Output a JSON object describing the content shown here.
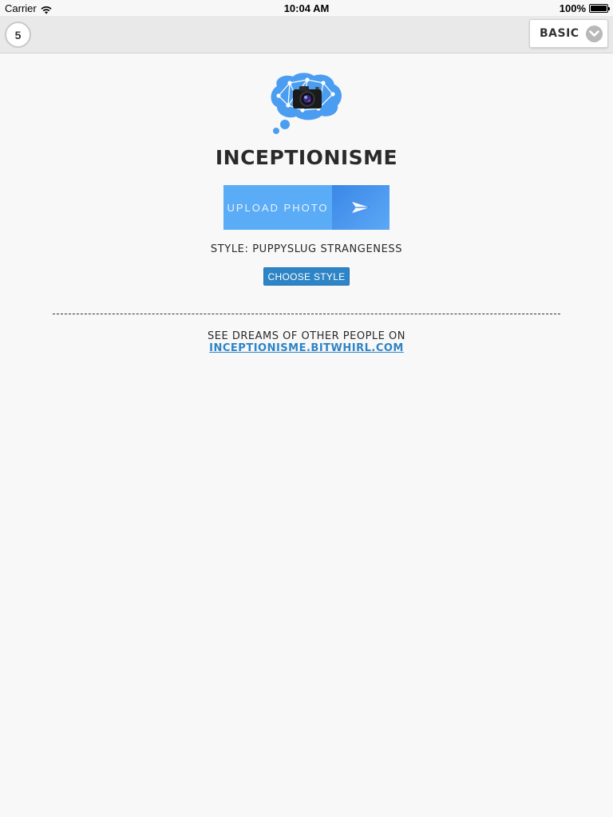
{
  "status_bar": {
    "carrier": "Carrier",
    "time": "10:04 AM",
    "battery": "100%",
    "battery_level": 1.0
  },
  "toolbar": {
    "count": "5",
    "mode_label": "BASIC"
  },
  "main": {
    "title": "INCEPTIONISME",
    "upload_label": "UPLOAD PHOTO",
    "style_text": "STYLE: PUPPYSLUG STRANGENESS",
    "choose_style_label": "CHOOSE STYLE",
    "dreams_text": "SEE DREAMS OF OTHER PEOPLE ON",
    "dreams_link": "INCEPTIONISME.BITWHIRL.COM"
  },
  "colors": {
    "accent": "#2d84c6",
    "upload_light": "#5aacf7",
    "upload_dark": "#3a87e6",
    "logo_blue": "#4a9df0",
    "background": "#f8f8f8",
    "toolbar": "#e9e9e9"
  },
  "icons": {
    "wifi": "wifi-icon",
    "battery": "battery-icon",
    "chevron": "chevron-down-icon",
    "send": "send-arrow-icon",
    "logo": "brain-camera-logo"
  }
}
